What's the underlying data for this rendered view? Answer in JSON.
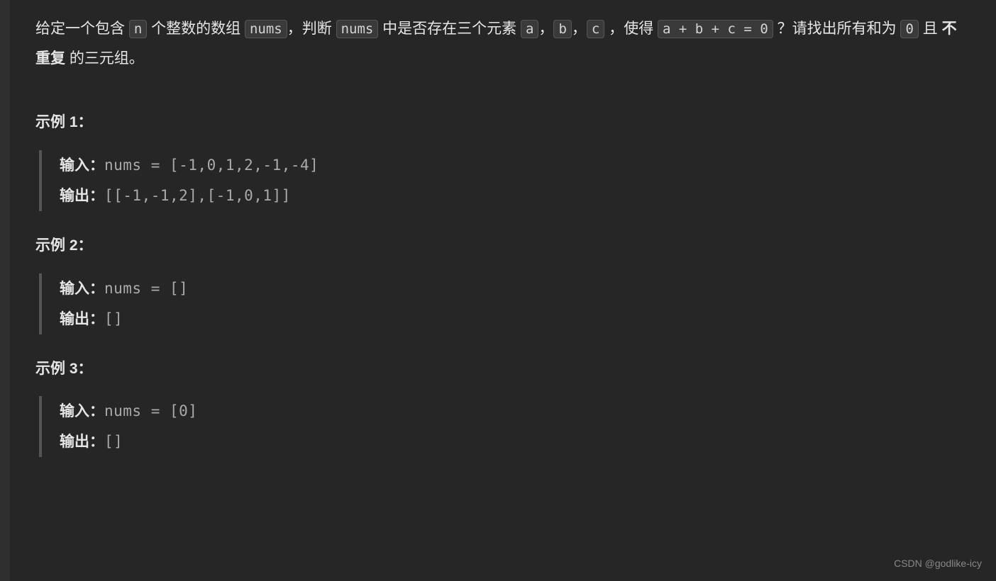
{
  "description": {
    "part1": "给定一个包含 ",
    "code1": "n",
    "part2": " 个整数的数组 ",
    "code2": "nums",
    "part3": "，判断 ",
    "code3": "nums",
    "part4": " 中是否存在三个元素 ",
    "code4": "a",
    "part5": "，",
    "code5": "b",
    "part6": "，",
    "code6": "c",
    "part7": " ，使得 ",
    "code7": "a + b + c = 0",
    "part8": " ？请找出所有和为 ",
    "code8": "0",
    "part9": " 且 ",
    "bold1": "不重复",
    "part10": " 的三元组。"
  },
  "examples": [
    {
      "title": "示例 1：",
      "input_label": "输入：",
      "input_value": "nums = [-1,0,1,2,-1,-4]",
      "output_label": "输出：",
      "output_value": "[[-1,-1,2],[-1,0,1]]"
    },
    {
      "title": "示例 2：",
      "input_label": "输入：",
      "input_value": "nums = []",
      "output_label": "输出：",
      "output_value": "[]"
    },
    {
      "title": "示例 3：",
      "input_label": "输入：",
      "input_value": "nums = [0]",
      "output_label": "输出：",
      "output_value": "[]"
    }
  ],
  "watermark": "CSDN @godlike-icy"
}
